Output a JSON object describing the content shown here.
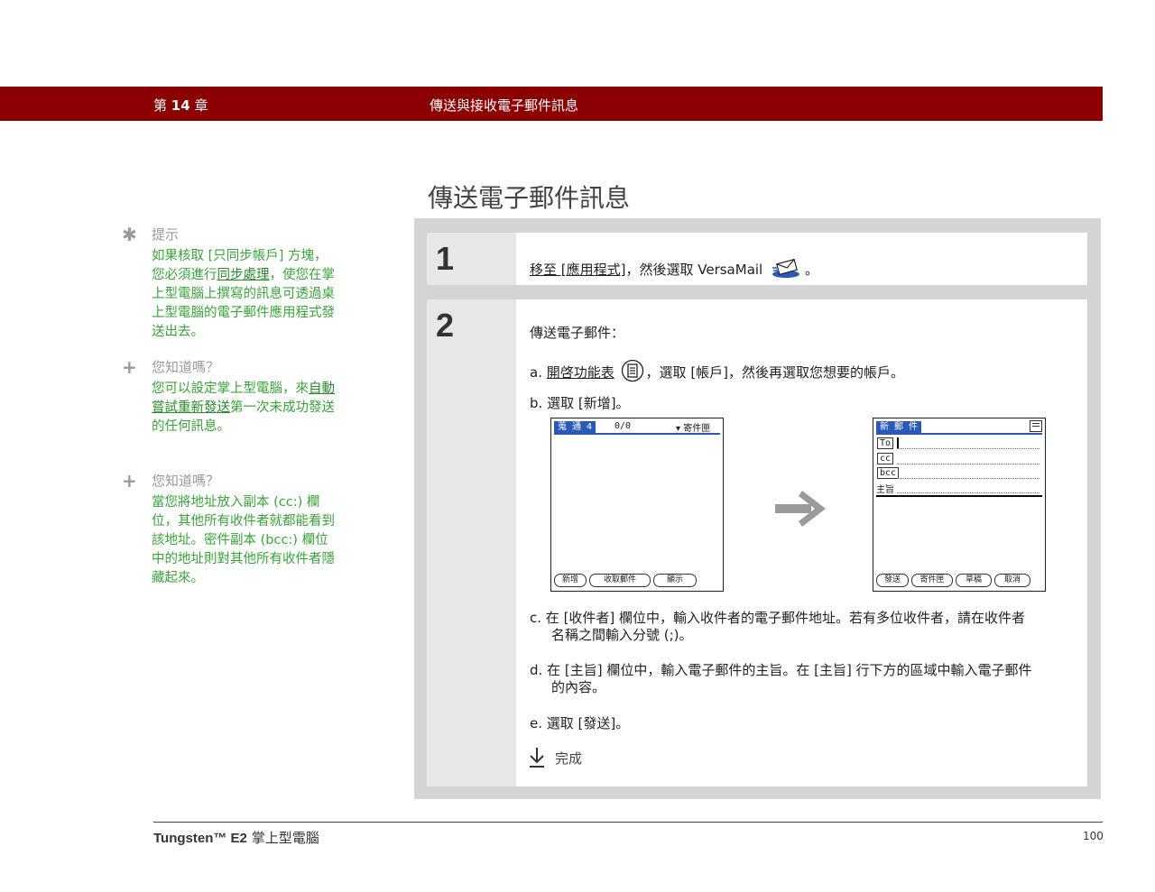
{
  "header": {
    "chapter_prefix": "第",
    "chapter_number": "14",
    "chapter_suffix": "章",
    "title": "傳送與接收電子郵件訊息"
  },
  "page_title": "傳送電子郵件訊息",
  "sidebar": [
    {
      "icon": "asterisk-icon",
      "label": "提示",
      "text_before": "如果核取 [只同步帳戶] 方塊，您必須進行",
      "link": "同步處理",
      "text_after": "，使您在掌上型電腦上撰寫的訊息可透過桌上型電腦的電子郵件應用程式發送出去。"
    },
    {
      "icon": "plus-icon",
      "label": "您知道嗎？",
      "text_before": "您可以設定掌上型電腦，來",
      "link": "自動嘗試重新發送",
      "text_after": "第一次未成功發送的任何訊息。"
    },
    {
      "icon": "plus-icon",
      "label": "您知道嗎？",
      "text_before": "當您將地址放入副本 (cc:) 欄位，其他所有收件者就都能看到該地址。密件副本 (bcc:) 欄位中的地址則對其他所有收件者隱藏起來。",
      "link": "",
      "text_after": ""
    }
  ],
  "steps": {
    "step1": {
      "number": "1",
      "link": "移至 [應用程式]",
      "text": "，然後選取 VersaMail",
      "end": "。"
    },
    "step2": {
      "number": "2",
      "intro": "傳送電子郵件：",
      "a_letter": "a.",
      "a_link": "開啓功能表",
      "a_text": "，選取 [帳戶]，然後再選取您想要的帳戶。",
      "b_letter": "b.",
      "b_text": "選取 [新增]。",
      "c_letter": "c.",
      "c_text1": "在 [收件者] 欄位中，輸入收件者的電子郵件地址。若有多位收件者，請在收件者",
      "c_text2": "名稱之間輸入分號 (;)。",
      "d_letter": "d.",
      "d_text1": "在 [主旨] 欄位中，輸入電子郵件的主旨。在 [主旨] 行下方的區域中輸入電子郵件",
      "d_text2": "的內容。",
      "e_letter": "e.",
      "e_text": "選取 [發送]。",
      "done": "完成"
    }
  },
  "screen_left": {
    "tab": "蒐 通 4",
    "count": "0/0",
    "folder": "▾ 寄件匣",
    "buttons": [
      "新增",
      "收取郵件",
      "顯示"
    ]
  },
  "screen_right": {
    "tab": "新 郵 件",
    "fields": [
      "To",
      "cc",
      "bcc",
      "主旨"
    ],
    "buttons": [
      "發送",
      "寄件匣",
      "草稿",
      "取消"
    ]
  },
  "footer": {
    "product": "Tungsten™ E2",
    "product_suffix": "掌上型電腦",
    "page": "100"
  },
  "colors": {
    "header": "#8b0000",
    "sidebar_text": "#3aa33a",
    "panel": "#d4d4d4",
    "palm_blue": "#2a5ab8"
  }
}
